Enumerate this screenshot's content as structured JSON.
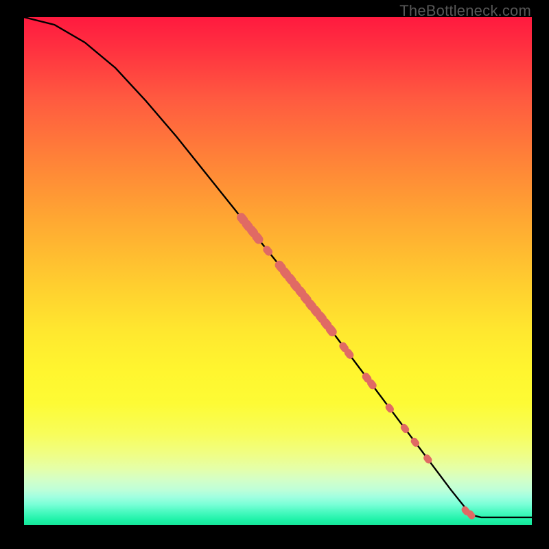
{
  "attribution": "TheBottleneck.com",
  "chart_data": {
    "type": "line",
    "title": "",
    "xlabel": "",
    "ylabel": "",
    "xlim": [
      0,
      100
    ],
    "ylim": [
      0,
      100
    ],
    "curve": [
      {
        "x": 0,
        "y": 100
      },
      {
        "x": 6,
        "y": 98.5
      },
      {
        "x": 12,
        "y": 95
      },
      {
        "x": 18,
        "y": 90
      },
      {
        "x": 24,
        "y": 83.5
      },
      {
        "x": 30,
        "y": 76.5
      },
      {
        "x": 36,
        "y": 69
      },
      {
        "x": 42,
        "y": 61.5
      },
      {
        "x": 48,
        "y": 54
      },
      {
        "x": 54,
        "y": 46.5
      },
      {
        "x": 60,
        "y": 39
      },
      {
        "x": 66,
        "y": 31
      },
      {
        "x": 72,
        "y": 23
      },
      {
        "x": 78,
        "y": 15
      },
      {
        "x": 84,
        "y": 7
      },
      {
        "x": 88,
        "y": 2
      },
      {
        "x": 90,
        "y": 1.5
      },
      {
        "x": 100,
        "y": 1.5
      }
    ],
    "markers": [
      {
        "x": 43.0,
        "y": 60.3,
        "r": 1.3
      },
      {
        "x": 44.0,
        "y": 59.0,
        "r": 1.3
      },
      {
        "x": 45.0,
        "y": 57.8,
        "r": 1.3
      },
      {
        "x": 46.0,
        "y": 56.5,
        "r": 1.3
      },
      {
        "x": 48.0,
        "y": 54.0,
        "r": 1.1
      },
      {
        "x": 50.5,
        "y": 50.9,
        "r": 1.3
      },
      {
        "x": 51.5,
        "y": 49.6,
        "r": 1.3
      },
      {
        "x": 52.5,
        "y": 48.4,
        "r": 1.3
      },
      {
        "x": 53.5,
        "y": 47.1,
        "r": 1.3
      },
      {
        "x": 54.5,
        "y": 45.9,
        "r": 1.3
      },
      {
        "x": 55.5,
        "y": 44.6,
        "r": 1.3
      },
      {
        "x": 56.5,
        "y": 43.3,
        "r": 1.3
      },
      {
        "x": 57.5,
        "y": 42.1,
        "r": 1.3
      },
      {
        "x": 58.5,
        "y": 40.9,
        "r": 1.3
      },
      {
        "x": 59.5,
        "y": 39.6,
        "r": 1.3
      },
      {
        "x": 60.5,
        "y": 38.3,
        "r": 1.3
      },
      {
        "x": 63.0,
        "y": 35.0,
        "r": 1.1
      },
      {
        "x": 64.0,
        "y": 33.7,
        "r": 1.1
      },
      {
        "x": 67.5,
        "y": 29.0,
        "r": 1.1
      },
      {
        "x": 68.5,
        "y": 27.7,
        "r": 1.1
      },
      {
        "x": 72.0,
        "y": 23.0,
        "r": 1.0
      },
      {
        "x": 75.0,
        "y": 19.0,
        "r": 1.0
      },
      {
        "x": 77.0,
        "y": 16.3,
        "r": 1.0
      },
      {
        "x": 79.5,
        "y": 13.0,
        "r": 1.0
      },
      {
        "x": 87.0,
        "y": 2.8,
        "r": 1.0
      },
      {
        "x": 88.0,
        "y": 2.0,
        "r": 1.0
      }
    ],
    "marker_color": "#e06a64",
    "curve_color": "#000000",
    "curve_width": 2.4
  }
}
